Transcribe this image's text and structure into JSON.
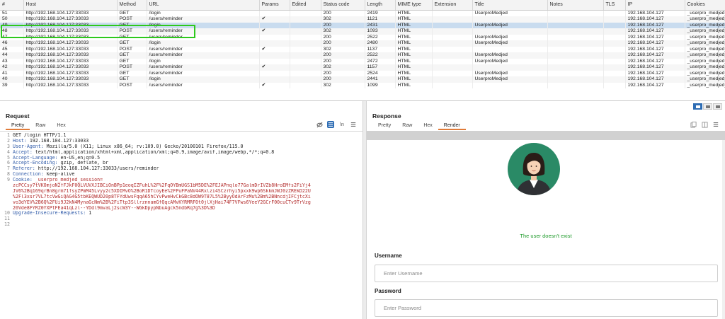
{
  "history": {
    "columns": [
      "#",
      "Host",
      "Method",
      "URL",
      "Params",
      "Edited",
      "Status code",
      "Length",
      "MIME type",
      "Extension",
      "Title",
      "Notes",
      "TLS",
      "IP",
      "Cookies"
    ],
    "rows": [
      {
        "num": "51",
        "host": "http://192.168.104.127:33033",
        "method": "GET",
        "url": "/login",
        "params": "",
        "status": "200",
        "length": "2419",
        "mime": "HTML",
        "title": "UserproMedjed",
        "ip": "192.168.104.127",
        "cookies": "_userpro_medjed_"
      },
      {
        "num": "50",
        "host": "http://192.168.104.127:33033",
        "method": "POST",
        "url": "/users/reminder",
        "params": "✔",
        "status": "302",
        "length": "1121",
        "mime": "HTML",
        "title": "",
        "ip": "192.168.104.127",
        "cookies": "_userpro_medjed_"
      },
      {
        "num": "49",
        "host": "http://192.168.104.127:33033",
        "method": "GET",
        "url": "/login",
        "params": "",
        "status": "200",
        "length": "2431",
        "mime": "HTML",
        "title": "UserproMedjed",
        "ip": "192.168.104.127",
        "cookies": "_userpro_medjed_"
      },
      {
        "num": "48",
        "host": "http://192.168.104.127:33033",
        "method": "POST",
        "url": "/users/reminder",
        "params": "✔",
        "status": "302",
        "length": "1093",
        "mime": "HTML",
        "title": "",
        "ip": "192.168.104.127",
        "cookies": "_userpro_medjed_"
      },
      {
        "num": "47",
        "host": "http://192.168.104.127:33033",
        "method": "GET",
        "url": "/users/reminder",
        "params": "",
        "status": "200",
        "length": "2522",
        "mime": "HTML",
        "title": "UserproMedjed",
        "ip": "192.168.104.127",
        "cookies": "_userpro_medjed_"
      },
      {
        "num": "46",
        "host": "http://192.168.104.127:33033",
        "method": "GET",
        "url": "/login",
        "params": "",
        "status": "200",
        "length": "2480",
        "mime": "HTML",
        "title": "UserproMedjed",
        "ip": "192.168.104.127",
        "cookies": "_userpro_medjed_"
      },
      {
        "num": "45",
        "host": "http://192.168.104.127:33033",
        "method": "POST",
        "url": "/users/reminder",
        "params": "✔",
        "status": "302",
        "length": "1137",
        "mime": "HTML",
        "title": "",
        "ip": "192.168.104.127",
        "cookies": "_userpro_medjed_"
      },
      {
        "num": "44",
        "host": "http://192.168.104.127:33033",
        "method": "GET",
        "url": "/users/reminder",
        "params": "",
        "status": "200",
        "length": "2522",
        "mime": "HTML",
        "title": "UserproMedjed",
        "ip": "192.168.104.127",
        "cookies": "_userpro_medjed_"
      },
      {
        "num": "43",
        "host": "http://192.168.104.127:33033",
        "method": "GET",
        "url": "/login",
        "params": "",
        "status": "200",
        "length": "2472",
        "mime": "HTML",
        "title": "UserproMedjed",
        "ip": "192.168.104.127",
        "cookies": "_userpro_medjed_"
      },
      {
        "num": "42",
        "host": "http://192.168.104.127:33033",
        "method": "POST",
        "url": "/users/reminder",
        "params": "✔",
        "status": "302",
        "length": "1157",
        "mime": "HTML",
        "title": "",
        "ip": "192.168.104.127",
        "cookies": "_userpro_medjed_"
      },
      {
        "num": "41",
        "host": "http://192.168.104.127:33033",
        "method": "GET",
        "url": "/users/reminder",
        "params": "",
        "status": "200",
        "length": "2524",
        "mime": "HTML",
        "title": "UserproMedjed",
        "ip": "192.168.104.127",
        "cookies": "_userpro_medjed_"
      },
      {
        "num": "40",
        "host": "http://192.168.104.127:33033",
        "method": "GET",
        "url": "/login",
        "params": "",
        "status": "200",
        "length": "2441",
        "mime": "HTML",
        "title": "UserproMedjed",
        "ip": "192.168.104.127",
        "cookies": "_userpro_medjed_"
      },
      {
        "num": "39",
        "host": "http://192.168.104.127:33033",
        "method": "POST",
        "url": "/users/reminder",
        "params": "✔",
        "status": "302",
        "length": "1099",
        "mime": "HTML",
        "title": "",
        "ip": "192.168.104.127",
        "cookies": "_userpro_medjed_"
      }
    ]
  },
  "request": {
    "title": "Request",
    "tabs": [
      "Pretty",
      "Raw",
      "Hex"
    ],
    "active_tab": "Pretty",
    "tool_icons": [
      "hide-icon",
      "format-icon",
      "newline-icon",
      "menu-icon"
    ],
    "lines": [
      {
        "n": "1",
        "key": "",
        "text": "GET /login HTTP/1.1"
      },
      {
        "n": "2",
        "key": "Host:",
        "text": " 192.168.104.127:33033"
      },
      {
        "n": "3",
        "key": "User-Agent:",
        "text": " Mozilla/5.0 (X11; Linux x86_64; rv:109.0) Gecko/20100101 Firefox/115.0"
      },
      {
        "n": "4",
        "key": "Accept:",
        "text": " text/html,application/xhtml+xml,application/xml;q=0.9,image/avif,image/webp,*/*;q=0.8"
      },
      {
        "n": "5",
        "key": "Accept-Language:",
        "text": " en-US,en;q=0.5"
      },
      {
        "n": "6",
        "key": "Accept-Encoding:",
        "text": " gzip, deflate, br"
      },
      {
        "n": "7",
        "key": "Referer:",
        "text": " http://192.168.104.127:33033/users/reminder"
      },
      {
        "n": "8",
        "key": "Connection:",
        "text": " keep-alive"
      },
      {
        "n": "9",
        "key": "Cookie:",
        "text": " _userpro_medjed_session="
      },
      {
        "n": "",
        "key": "",
        "cookie": "zcPCCsy7tVKOmjoN2fFJkF0QLVUVXJIBCiOnBPp1eoqIZFuhL%2F%2FqOYBmUGS1bM5DE%2FEJAPnqlo77GalmDrIVZb8HroEMfs2FiYj4"
      },
      {
        "n": "",
        "key": "",
        "cookie": "JV6%2Bq169qrBn8grm71fsyZPmM45Lvyy2c5XDIMvO%2BoR1DTcoyEe%2FPuFPaNV44Rxlzi4SCzrhyi5pxxk9wp6SkkmJWJ0zZREkD22U"
      },
      {
        "n": "",
        "key": "",
        "cookie": "%2Fl3xsr7VL7tcVwGiQAG4G5tbKEQWUD20p8TFYdUwsFqqA65hCYvPweHvCkGBc8dOW9T87L5%2ByyOdArFzMu%2Bm%2BNncdjIFCjtcXi"
      },
      {
        "n": "",
        "key": "",
        "cookie": "vo3dYEV%2B6Q%2FUi9J2kN4MynaGcNm%2B%2FiTtp3SllrznnamGfQqcAMvKYRMRF0t0jlXjHai74F7VFws6YeeY2GCrF00cuCTv9TrVzg"
      },
      {
        "n": "",
        "key": "",
        "cookie": "20Vde8FYRZ0YXPtFEa41qLzl--YDdl9mvaLj2scW3Y--WGkDpypNbuAgck5ndbRq7g%3D%3D"
      },
      {
        "n": "10",
        "key": "Upgrade-Insecure-Requests:",
        "text": " 1"
      },
      {
        "n": "11",
        "key": "",
        "text": ""
      },
      {
        "n": "12",
        "key": "",
        "text": ""
      }
    ]
  },
  "response": {
    "title": "Response",
    "tabs": [
      "Pretty",
      "Raw",
      "Hex",
      "Render"
    ],
    "active_tab": "Render",
    "status_message": "The user doesn't exist",
    "username_label": "Username",
    "username_placeholder": "Enter Username",
    "password_label": "Password",
    "password_placeholder": "Enter Password"
  },
  "colors": {
    "selected_row": "#c9dcef",
    "highlight_box": "#2dc91c",
    "accent_tab": "#e07b39",
    "success_text": "#1e9a2a",
    "avatar_bg": "#2a8a66"
  }
}
